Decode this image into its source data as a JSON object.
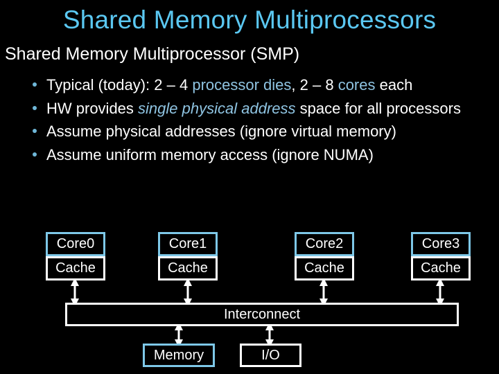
{
  "slide": {
    "title": "Shared Memory Multiprocessors",
    "subtitle": "Shared Memory Multiprocessor (SMP)",
    "bullets": [
      {
        "parts": [
          "Typical (today): 2 – 4 ",
          "processor dies",
          ", 2 – 8 ",
          "cores",
          " each"
        ]
      },
      {
        "parts": [
          "HW provides ",
          "single physical address",
          " space for all processors"
        ]
      },
      {
        "parts": [
          "Assume physical addresses (ignore virtual memory)"
        ]
      },
      {
        "parts": [
          "Assume uniform memory access (ignore NUMA)"
        ]
      }
    ]
  },
  "diagram": {
    "cores": [
      {
        "core": "Core0",
        "cache": "Cache"
      },
      {
        "core": "Core1",
        "cache": "Cache"
      },
      {
        "core": "Core2",
        "cache": "Cache"
      },
      {
        "core": "Core3",
        "cache": "Cache"
      }
    ],
    "interconnect": "Interconnect",
    "memory": "Memory",
    "io": "I/O",
    "colors": {
      "accent": "#5bc8f2",
      "core_border": "#7ec8e8",
      "highlight_text": "#8fc4e2"
    }
  }
}
